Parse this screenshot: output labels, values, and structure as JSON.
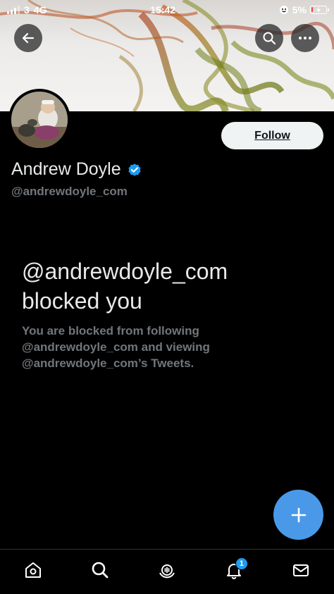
{
  "status_bar": {
    "carrier": "3",
    "network": "4G",
    "time": "15:42",
    "battery_percent": "5%"
  },
  "profile": {
    "display_name": "Andrew Doyle",
    "handle": "@andrewdoyle_com",
    "verified": true,
    "follow_label": "Follow"
  },
  "blocked": {
    "title": "@andrewdoyle_com blocked you",
    "description": "You are blocked from following @andrewdoyle_com and viewing @andrewdoyle_com’s Tweets."
  },
  "bottom_nav": {
    "items": [
      {
        "icon": "home-icon"
      },
      {
        "icon": "search-icon"
      },
      {
        "icon": "spaces-icon"
      },
      {
        "icon": "notifications-icon",
        "badge": "1"
      },
      {
        "icon": "messages-icon"
      }
    ]
  },
  "colors": {
    "background": "#000000",
    "accent": "#1d9bf0",
    "fab": "#4a99e9",
    "muted_text": "#71767b",
    "follow_button": "#eff3f4"
  }
}
